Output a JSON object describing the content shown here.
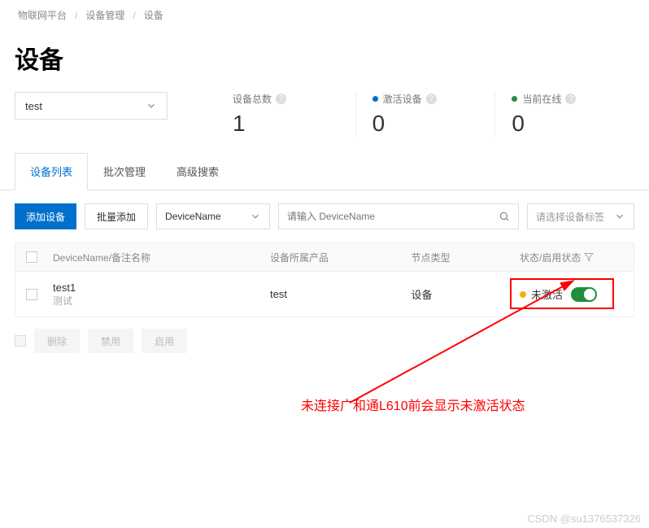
{
  "breadcrumb": {
    "item1": "物联网平台",
    "item2": "设备管理",
    "item3": "设备"
  },
  "page_title": "设备",
  "product_selector": {
    "value": "test"
  },
  "stats": {
    "total": {
      "label": "设备总数",
      "value": "1"
    },
    "activated": {
      "label": "激活设备",
      "value": "0"
    },
    "online": {
      "label": "当前在线",
      "value": "0"
    }
  },
  "tabs": {
    "list": "设备列表",
    "batch": "批次管理",
    "advanced": "高级搜索"
  },
  "toolbar": {
    "add_device": "添加设备",
    "batch_add": "批量添加",
    "filter_type": "DeviceName",
    "search_placeholder": "请输入 DeviceName",
    "tag_placeholder": "请选择设备标签"
  },
  "table": {
    "columns": {
      "name": "DeviceName/备注名称",
      "product": "设备所属产品",
      "node_type": "节点类型",
      "status": "状态/启用状态"
    },
    "rows": [
      {
        "name": "test1",
        "note": "测试",
        "product": "test",
        "node_type": "设备",
        "status": "未激活"
      }
    ]
  },
  "footer": {
    "delete": "删除",
    "disable": "禁用",
    "enable": "启用"
  },
  "annotation": "未连接广和通L610前会显示未激活状态",
  "watermark": "CSDN @su1376537326"
}
